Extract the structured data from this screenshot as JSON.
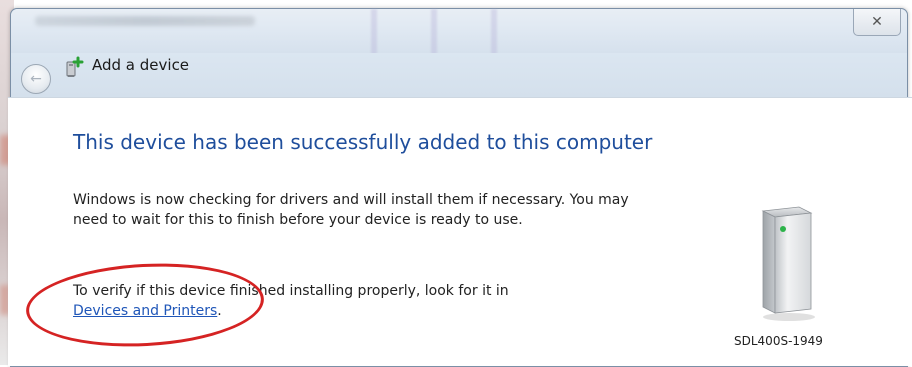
{
  "window": {
    "close_icon_glyph": "✕"
  },
  "nav": {
    "back_glyph": "←",
    "title": "Add a device"
  },
  "main": {
    "heading": "This device has been successfully added to this computer",
    "body": "Windows is now checking for drivers and will install them if necessary. You may need to wait for this to finish before your device is ready to use.",
    "verify_prefix": "To verify if this device finished installing properly, look for it in",
    "verify_link": "Devices and Printers",
    "verify_suffix": "."
  },
  "device": {
    "name": "SDL400S-1949",
    "icon": "computer-tower-icon"
  },
  "colors": {
    "heading": "#1f4e9c",
    "link": "#1f56b8",
    "annotation_circle": "#d52323"
  }
}
